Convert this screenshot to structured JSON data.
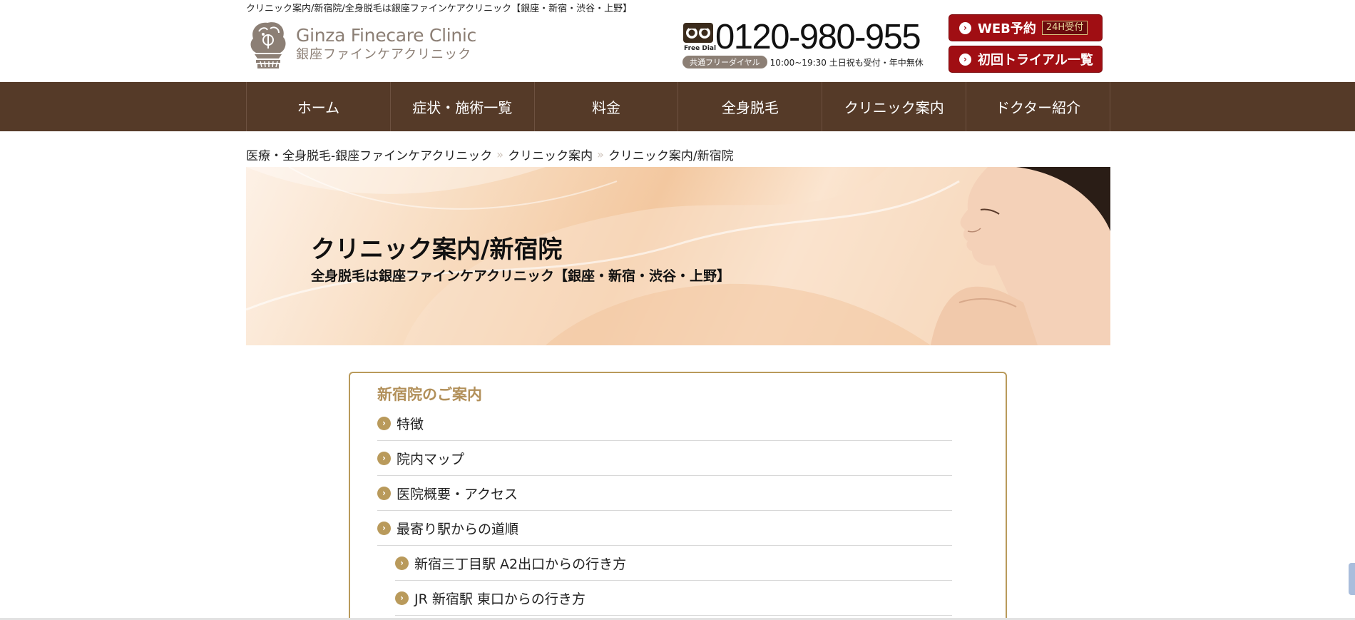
{
  "header": {
    "tagline": "クリニック案内/新宿院/全身脱毛は銀座ファインケアクリニック【銀座・新宿・渋谷・上野】",
    "logo_en": "Ginza Finecare Clinic",
    "logo_ja": "銀座ファインケアクリニック",
    "phone": {
      "freedial_label": "Free Dial",
      "number": "0120-980-955",
      "pill": "共通フリーダイヤル",
      "hours": "10:00~19:30 土日祝も受付・年中無休"
    },
    "web_reserve": {
      "label": "WEB予約",
      "badge": "24H受付"
    },
    "trial_list": {
      "label": "初回トライアル一覧"
    }
  },
  "nav": {
    "items": [
      {
        "label": "ホーム"
      },
      {
        "label": "症状・施術一覧"
      },
      {
        "label": "料金"
      },
      {
        "label": "全身脱毛"
      },
      {
        "label": "クリニック案内"
      },
      {
        "label": "ドクター紹介"
      }
    ]
  },
  "breadcrumb": {
    "items": [
      {
        "label": "医療・全身脱毛-銀座ファインケアクリニック"
      },
      {
        "label": "クリニック案内"
      },
      {
        "label": "クリニック案内/新宿院"
      }
    ],
    "separator": "»"
  },
  "hero": {
    "title": "クリニック案内/新宿院",
    "subtitle": "全身脱毛は銀座ファインケアクリニック【銀座・新宿・渋谷・上野】"
  },
  "toc": {
    "title": "新宿院のご案内",
    "items": [
      {
        "label": "特徴",
        "level": 1
      },
      {
        "label": "院内マップ",
        "level": 1
      },
      {
        "label": "医院概要・アクセス",
        "level": 1
      },
      {
        "label": "最寄り駅からの道順",
        "level": 1
      },
      {
        "label": "新宿三丁目駅 A2出口からの行き方",
        "level": 2
      },
      {
        "label": "JR 新宿駅 東口からの行き方",
        "level": 2
      }
    ]
  },
  "colors": {
    "nav_bg": "#553a28",
    "accent_red": "#a00e13",
    "gold": "#b99a5b",
    "logo_gray": "#8c7f75"
  },
  "icons": {
    "arrow": "›",
    "bullet": "chevron-right-circle-icon"
  }
}
